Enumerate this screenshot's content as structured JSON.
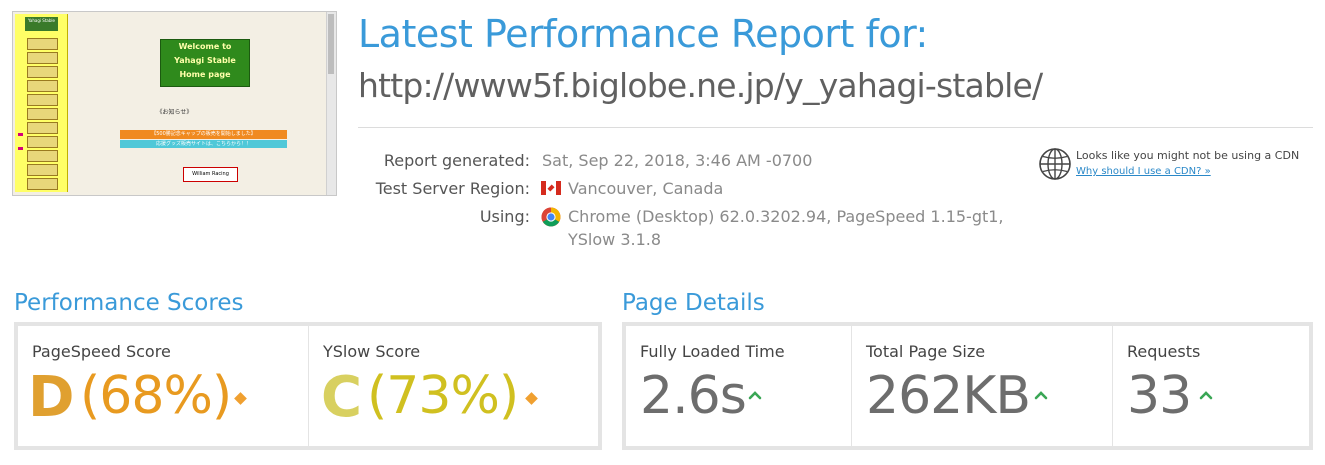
{
  "thumbnail": {
    "sidebar_logo": "Yahagi Stable",
    "sidebar_items": [
      "",
      "",
      "",
      "",
      "",
      "",
      "",
      "",
      "",
      "",
      ""
    ],
    "welcome_lines": [
      "Welcome to",
      "Yahagi Stable",
      "Home page"
    ],
    "notice": "《お知らせ》",
    "banner1": "【500勝記念キャップの販売を開始しました】",
    "banner2": "応援グッズ販売サイトは、こちらから！！",
    "badge": "William Racing"
  },
  "header": {
    "title": "Latest Performance Report for:",
    "url": "http://www5f.biglobe.ne.jp/y_yahagi-stable/"
  },
  "meta": {
    "report_generated_label": "Report generated:",
    "report_generated_value": "Sat, Sep 22, 2018, 3:46 AM -0700",
    "region_label": "Test Server Region:",
    "region_value": "Vancouver, Canada",
    "using_label": "Using:",
    "using_line1": "Chrome (Desktop) 62.0.3202.94, PageSpeed 1.15-gt1,",
    "using_line2": "YSlow 3.1.8"
  },
  "cdn": {
    "notice": "Looks like you might not be using a CDN",
    "link": "Why should I use a CDN? »"
  },
  "performance": {
    "title": "Performance Scores",
    "pagespeed": {
      "label": "PageSpeed Score",
      "grade": "D",
      "percent": "(68%)",
      "color": "#e8a020"
    },
    "yslow": {
      "label": "YSlow Score",
      "grade": "C",
      "percent": "(73%)",
      "color": "#d4c020"
    }
  },
  "details": {
    "title": "Page Details",
    "load_time": {
      "label": "Fully Loaded Time",
      "value": "2.6s"
    },
    "page_size": {
      "label": "Total Page Size",
      "value": "262KB"
    },
    "requests": {
      "label": "Requests",
      "value": "33"
    }
  },
  "colors": {
    "accent": "#3a9ad9",
    "up_arrow": "#3aa655",
    "diamond": "#f0a030"
  }
}
